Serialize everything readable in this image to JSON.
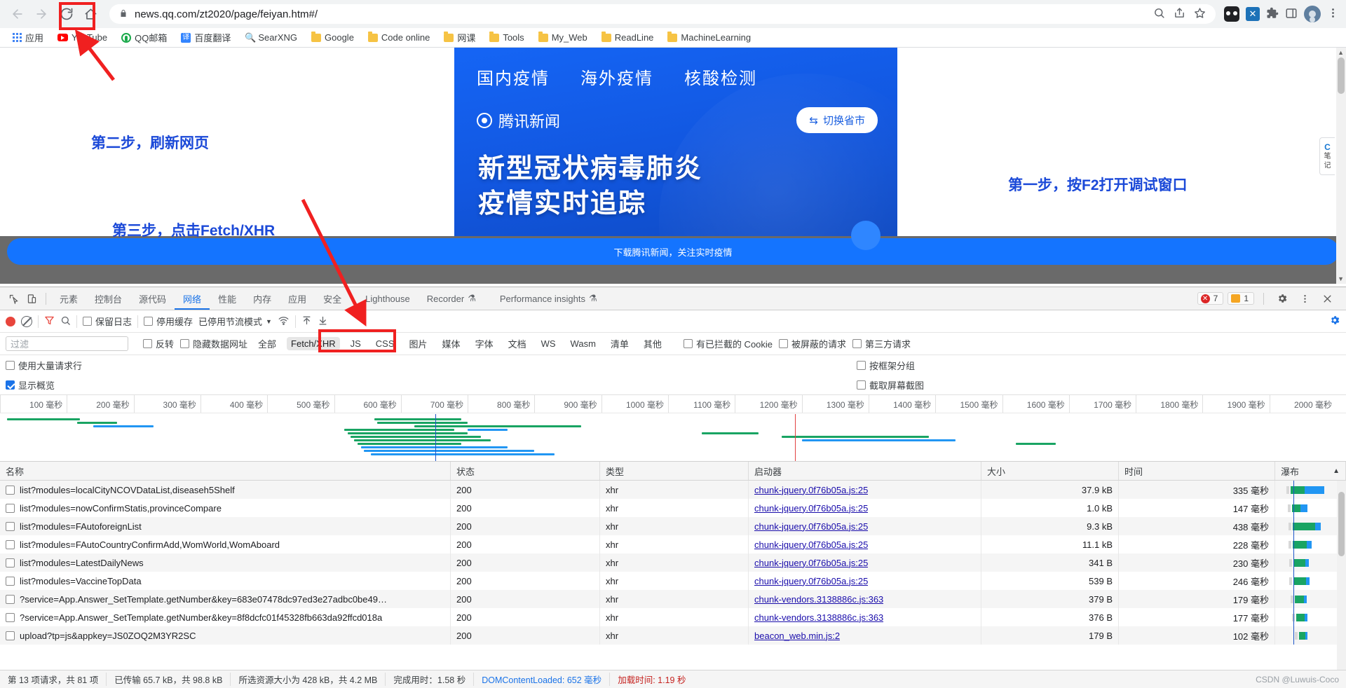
{
  "browser": {
    "url": "news.qq.com/zt2020/page/feiyan.htm#/",
    "back_icon": "back-arrow-icon",
    "forward_icon": "forward-arrow-icon",
    "reload_icon": "reload-icon",
    "home_icon": "home-icon",
    "lock_icon": "lock-icon",
    "search_icon": "search-icon",
    "share_icon": "share-icon",
    "star_icon": "star-icon",
    "puzzle_icon": "extensions-puzzle-icon",
    "sidepanel_icon": "side-panel-icon",
    "menu_icon": "three-dot-menu-icon",
    "bookmarks": [
      {
        "label": "应用",
        "icon": "apps-grid-icon"
      },
      {
        "label": "YouTube",
        "icon": "youtube-icon"
      },
      {
        "label": "QQ邮箱",
        "icon": "qqmail-icon"
      },
      {
        "label": "百度翻译",
        "icon": "baidu-translate-icon"
      },
      {
        "label": "SearXNG",
        "icon": "searxng-icon"
      },
      {
        "label": "Google",
        "icon": "folder-icon"
      },
      {
        "label": "Code online",
        "icon": "folder-icon"
      },
      {
        "label": "网课",
        "icon": "folder-icon"
      },
      {
        "label": "Tools",
        "icon": "folder-icon"
      },
      {
        "label": "My_Web",
        "icon": "folder-icon"
      },
      {
        "label": "ReadLine",
        "icon": "folder-icon"
      },
      {
        "label": "MachineLearning",
        "icon": "folder-icon"
      }
    ]
  },
  "annotations": [
    {
      "id": "step2",
      "text": "第二步，刷新网页"
    },
    {
      "id": "step3",
      "text": "第三步，点击Fetch/XHR"
    },
    {
      "id": "step1",
      "text": "第一步，按F2打开调试窗口"
    }
  ],
  "page": {
    "nav": [
      "国内疫情",
      "海外疫情",
      "核酸检测"
    ],
    "brand": "腾讯新闻",
    "switch_province": "切换省市",
    "switch_icon": "swap-icon",
    "title_line1": "新型冠状病毒肺炎",
    "title_line2": "疫情实时追踪",
    "download_bar": "下载腾讯新闻，关注实时疫情",
    "note_tab": {
      "top": "C",
      "lines": [
        "笔",
        "记"
      ]
    }
  },
  "devtools": {
    "inspect_icon": "inspect-element-icon",
    "device_icon": "device-toolbar-icon",
    "tabs": [
      {
        "label": "元素",
        "active": false
      },
      {
        "label": "控制台",
        "active": false
      },
      {
        "label": "源代码",
        "active": false
      },
      {
        "label": "网络",
        "active": true
      },
      {
        "label": "性能",
        "active": false
      },
      {
        "label": "内存",
        "active": false
      },
      {
        "label": "应用",
        "active": false
      },
      {
        "label": "安全",
        "active": false
      },
      {
        "label": "Lighthouse",
        "active": false
      },
      {
        "label": "Recorder",
        "active": false,
        "beaker": true
      },
      {
        "label": "Performance insights",
        "active": false,
        "beaker": true
      }
    ],
    "error_count": "7",
    "warning_count": "1",
    "settings_icon": "gear-icon",
    "more_icon": "three-dot-menu-icon",
    "close_icon": "close-icon",
    "toolbar": {
      "record_icon": "record-stop-icon",
      "clear_icon": "clear-network-icon",
      "filter_icon": "filter-funnel-icon",
      "search_icon": "search-icon",
      "preserve_log": "保留日志",
      "disable_cache": "停用缓存",
      "throttle": "已停用节流模式",
      "throttle_caret": "chevron-down-icon",
      "wifi_icon": "network-conditions-icon",
      "import_icon": "import-har-icon",
      "export_icon": "export-har-icon",
      "prefs_icon": "network-settings-icon"
    },
    "filterbar": {
      "filter_placeholder": "过滤",
      "invert": "反转",
      "hide_data_urls": "隐藏数据网址",
      "types": [
        "全部",
        "Fetch/XHR",
        "JS",
        "CSS",
        "图片",
        "媒体",
        "字体",
        "文档",
        "WS",
        "Wasm",
        "清单",
        "其他"
      ],
      "selected_type": "Fetch/XHR",
      "blocked_cookies": "有已拦截的 Cookie",
      "blocked_requests": "被屏蔽的请求",
      "third_party": "第三方请求"
    },
    "options": {
      "big_request_rows": "使用大量请求行",
      "group_by_frame": "按框架分组",
      "show_overview": "显示概览",
      "capture_screenshots": "截取屏幕截图"
    },
    "overview": {
      "ticks": [
        "100 毫秒",
        "200 毫秒",
        "300 毫秒",
        "400 毫秒",
        "500 毫秒",
        "600 毫秒",
        "700 毫秒",
        "800 毫秒",
        "900 毫秒",
        "1000 毫秒",
        "1100 毫秒",
        "1200 毫秒",
        "1300 毫秒",
        "1400 毫秒",
        "1500 毫秒",
        "1600 毫秒",
        "1700 毫秒",
        "1800 毫秒",
        "1900 毫秒",
        "2000 毫秒"
      ],
      "dcl_position_ms": 652,
      "load_position_ms": 1190
    },
    "table": {
      "headers": [
        "名称",
        "状态",
        "类型",
        "启动器",
        "大小",
        "时间",
        "瀑布"
      ],
      "sort_icon": "sort-ascending-icon",
      "rows": [
        {
          "name": "list?modules=localCityNCOVDataList,diseaseh5Shelf",
          "status": "200",
          "type": "xhr",
          "initiator": "chunk-jquery.0f76b05a.js:25",
          "size": "37.9 kB",
          "time": "335 毫秒",
          "wf_start": 22,
          "wf_green": 20,
          "wf_blue": 28
        },
        {
          "name": "list?modules=nowConfirmStatis,provinceCompare",
          "status": "200",
          "type": "xhr",
          "initiator": "chunk-jquery.0f76b05a.js:25",
          "size": "1.0 kB",
          "time": "147 毫秒",
          "wf_start": 24,
          "wf_green": 12,
          "wf_blue": 10
        },
        {
          "name": "list?modules=FAutoforeignList",
          "status": "200",
          "type": "xhr",
          "initiator": "chunk-jquery.0f76b05a.js:25",
          "size": "9.3 kB",
          "time": "438 毫秒",
          "wf_start": 25,
          "wf_green": 32,
          "wf_blue": 8
        },
        {
          "name": "list?modules=FAutoCountryConfirmAdd,WomWorld,WomAboard",
          "status": "200",
          "type": "xhr",
          "initiator": "chunk-jquery.0f76b05a.js:25",
          "size": "11.1 kB",
          "time": "228 毫秒",
          "wf_start": 25,
          "wf_green": 20,
          "wf_blue": 7
        },
        {
          "name": "list?modules=LatestDailyNews",
          "status": "200",
          "type": "xhr",
          "initiator": "chunk-jquery.0f76b05a.js:25",
          "size": "341 B",
          "time": "230 毫秒",
          "wf_start": 26,
          "wf_green": 17,
          "wf_blue": 5
        },
        {
          "name": "list?modules=VaccineTopData",
          "status": "200",
          "type": "xhr",
          "initiator": "chunk-jquery.0f76b05a.js:25",
          "size": "539 B",
          "time": "246 毫秒",
          "wf_start": 26,
          "wf_green": 18,
          "wf_blue": 5
        },
        {
          "name": "?service=App.Answer_SetTemplate.getNumber&key=683e07478dc97ed3e27adbc0be49…",
          "status": "200",
          "type": "xhr",
          "initiator": "chunk-vendors.3138886c.js:363",
          "size": "379 B",
          "time": "179 毫秒",
          "wf_start": 28,
          "wf_green": 13,
          "wf_blue": 4
        },
        {
          "name": "?service=App.Answer_SetTemplate.getNumber&key=8f8dcfc01f45328fb663da92ffcd018a",
          "status": "200",
          "type": "xhr",
          "initiator": "chunk-vendors.3138886c.js:363",
          "size": "376 B",
          "time": "177 毫秒",
          "wf_start": 30,
          "wf_green": 12,
          "wf_blue": 4
        },
        {
          "name": "upload?tp=js&appkey=JS0ZOQ2M3YR2SC",
          "status": "200",
          "type": "xhr",
          "initiator": "beacon_web.min.js:2",
          "size": "179 B",
          "time": "102 毫秒",
          "wf_start": 34,
          "wf_green": 9,
          "wf_blue": 3
        }
      ]
    },
    "statusbar": {
      "requests": "第 13 项请求，共 81 项",
      "transferred": "已传输 65.7 kB，共 98.8 kB",
      "resources": "所选资源大小为 428 kB，共 4.2 MB",
      "finish": "完成用时：1.58 秒",
      "dcl_label": "DOMContentLoaded:",
      "dcl_value": "652 毫秒",
      "load_label": "加载时间:",
      "load_value": "1.19 秒",
      "watermark": "CSDN @Luwuis-Coco"
    }
  },
  "colors": {
    "accent_blue": "#1a73e8",
    "annotation_blue": "#1b49d8",
    "annotation_red": "#f02020",
    "waterfall_green": "#19a463",
    "waterfall_blue": "#2196f3",
    "dcl_blue": "#1e56c9",
    "load_red": "#e24242",
    "banner_blue": "#1257e0"
  }
}
